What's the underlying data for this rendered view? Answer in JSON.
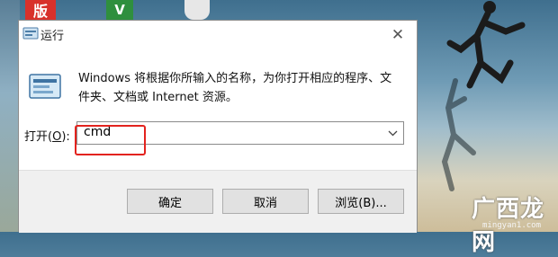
{
  "desktop": {
    "app_icon_1": "版",
    "app_icon_2": "V",
    "watermark_text": "广西龙网",
    "watermark_url": "mingyan1.com"
  },
  "dialog": {
    "title": "运行",
    "close_icon": "✕",
    "description": "Windows 将根据你所输入的名称，为你打开相应的程序、文件夹、文档或 Internet 资源。",
    "open_label_prefix": "打开(",
    "open_label_key": "O",
    "open_label_suffix": "):",
    "open_value": "cmd",
    "buttons": {
      "ok": "确定",
      "cancel": "取消",
      "browse": "浏览(B)..."
    }
  },
  "colors": {
    "highlight": "#e3231e",
    "dialog_bg": "#ffffff",
    "footer_bg": "#f0f0f0"
  }
}
